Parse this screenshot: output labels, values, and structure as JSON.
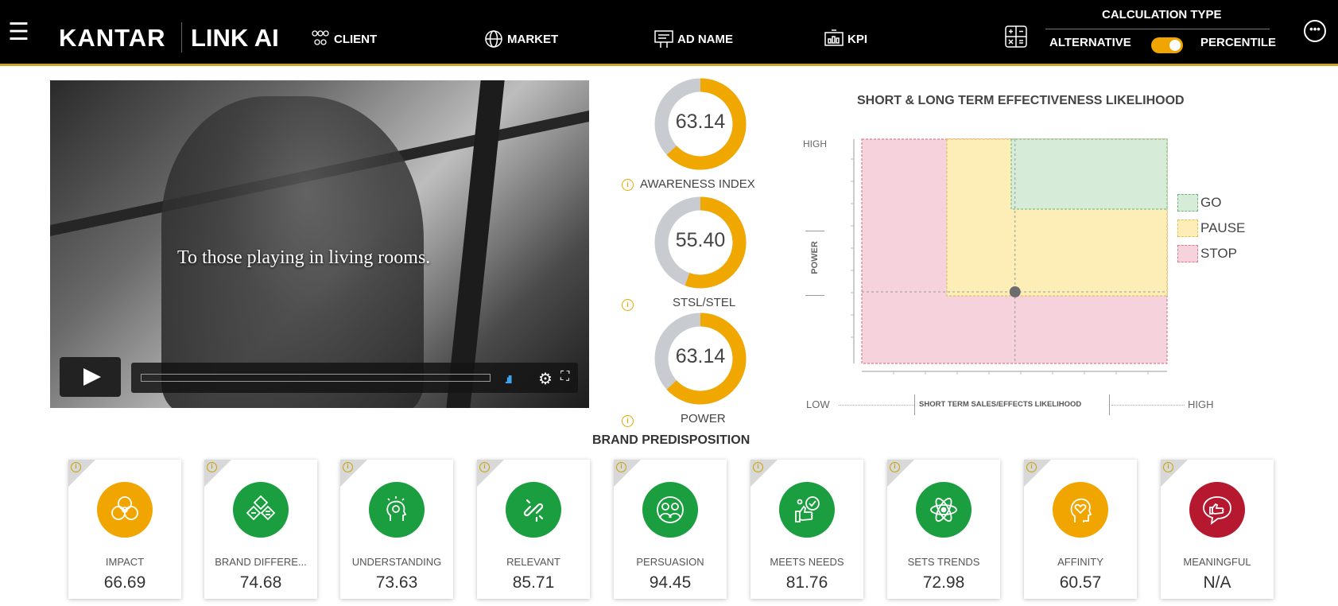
{
  "header": {
    "brand": "KANTAR",
    "product": "LINK AI",
    "nav": [
      {
        "label": "CLIENT",
        "icon": "people-group-icon"
      },
      {
        "label": "MARKET",
        "icon": "globe-icon"
      },
      {
        "label": "AD NAME",
        "icon": "billboard-icon"
      },
      {
        "label": "KPI",
        "icon": "chart-board-icon"
      }
    ],
    "calculation": {
      "title": "CALCULATION TYPE",
      "left_option": "ALTERNATIVE",
      "right_option": "PERCENTILE",
      "selected": "PERCENTILE"
    }
  },
  "video": {
    "caption": "To those playing in living rooms.",
    "progress": 0
  },
  "metrics": [
    {
      "value": "63.14",
      "label": "AWARENESS INDEX",
      "fraction": 0.6314
    },
    {
      "value": "55.40",
      "label": "STSL/STEL",
      "fraction": 0.554
    },
    {
      "value": "63.14",
      "label": "POWER",
      "fraction": 0.6314
    }
  ],
  "quadrant": {
    "title": "SHORT & LONG TERM EFFECTIVENESS LIKELIHOOD",
    "y_high": "HIGH",
    "y_axis": "POWER",
    "x_low": "LOW",
    "x_axis": "SHORT TERM SALES/EFFECTS LIKELIHOOD",
    "x_high": "HIGH",
    "legend": [
      {
        "label": "GO",
        "color": "#5cb85c"
      },
      {
        "label": "PAUSE",
        "color": "#f0c419"
      },
      {
        "label": "STOP",
        "color": "#d9534f"
      }
    ],
    "point": {
      "x": 55.4,
      "y": 63.14
    }
  },
  "brand_predisposition": {
    "title": "BRAND PREDISPOSITION",
    "cards": [
      {
        "label": "IMPACT",
        "value": "66.69",
        "color": "#f0a500",
        "icon": "impact-icon"
      },
      {
        "label": "BRAND DIFFERE...",
        "value": "74.68",
        "color": "#1a9e3f",
        "icon": "diamonds-icon"
      },
      {
        "label": "UNDERSTANDING",
        "value": "73.63",
        "color": "#1a9e3f",
        "icon": "head-idea-icon"
      },
      {
        "label": "RELEVANT",
        "value": "85.71",
        "color": "#1a9e3f",
        "icon": "link-icon"
      },
      {
        "label": "PERSUASION",
        "value": "94.45",
        "color": "#1a9e3f",
        "icon": "persuasion-icon"
      },
      {
        "label": "MEETS NEEDS",
        "value": "81.76",
        "color": "#1a9e3f",
        "icon": "thumbs-check-icon"
      },
      {
        "label": "SETS TRENDS",
        "value": "72.98",
        "color": "#1a9e3f",
        "icon": "atom-icon"
      },
      {
        "label": "AFFINITY",
        "value": "60.57",
        "color": "#f0a500",
        "icon": "head-heart-icon"
      },
      {
        "label": "MEANINGFUL",
        "value": "N/A",
        "color": "#b5182f",
        "icon": "thumbs-bubble-icon"
      }
    ]
  }
}
